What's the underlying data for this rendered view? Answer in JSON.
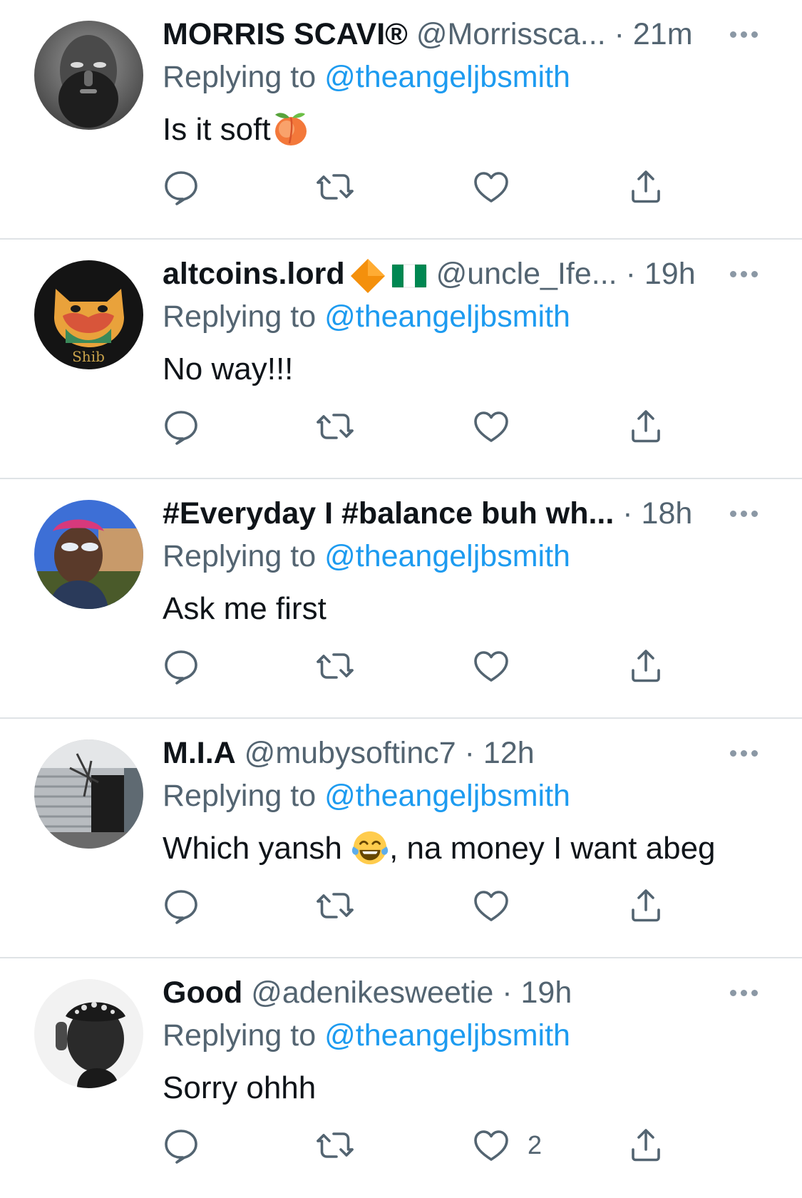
{
  "reply_prefix": "Replying to",
  "tweets": [
    {
      "name": "MORRIS SCAVI®",
      "handle": "@Morrissca...",
      "separator": "·",
      "time": "21m",
      "reply_to": "@theangeljbsmith",
      "text": "Is it soft",
      "emoji": "peach",
      "like_count": ""
    },
    {
      "name": "altcoins.lord",
      "handle": "@uncle_Ife...",
      "separator": "·",
      "time": "19h",
      "reply_to": "@theangeljbsmith",
      "text": "No way!!!",
      "badges": [
        "orange-diamond",
        "nigeria-flag"
      ],
      "avatar_text": "Shib",
      "like_count": ""
    },
    {
      "name": "#Everyday I #balance buh wh...",
      "handle": "",
      "separator": "·",
      "time": "18h",
      "reply_to": "@theangeljbsmith",
      "text": "Ask me first",
      "like_count": ""
    },
    {
      "name": "M.I.A",
      "handle": "@mubysoftinc7",
      "separator": "·",
      "time": "12h",
      "reply_to": "@theangeljbsmith",
      "text_before": "Which yansh ",
      "emoji": "face-with-tears-of-joy",
      "text_after": ", na money I want abeg",
      "like_count": ""
    },
    {
      "name": "Good",
      "handle": "@adenikesweetie",
      "separator": "·",
      "time": "19h",
      "reply_to": "@theangeljbsmith",
      "text": "Sorry ohhh",
      "like_count": "2"
    }
  ],
  "colors": {
    "link": "#1d9bf0",
    "secondary_text": "#536471",
    "divider": "#dfe3e6",
    "icon": "#536471"
  },
  "icons": [
    "reply-icon",
    "retweet-icon",
    "like-icon",
    "share-icon",
    "more-icon"
  ]
}
